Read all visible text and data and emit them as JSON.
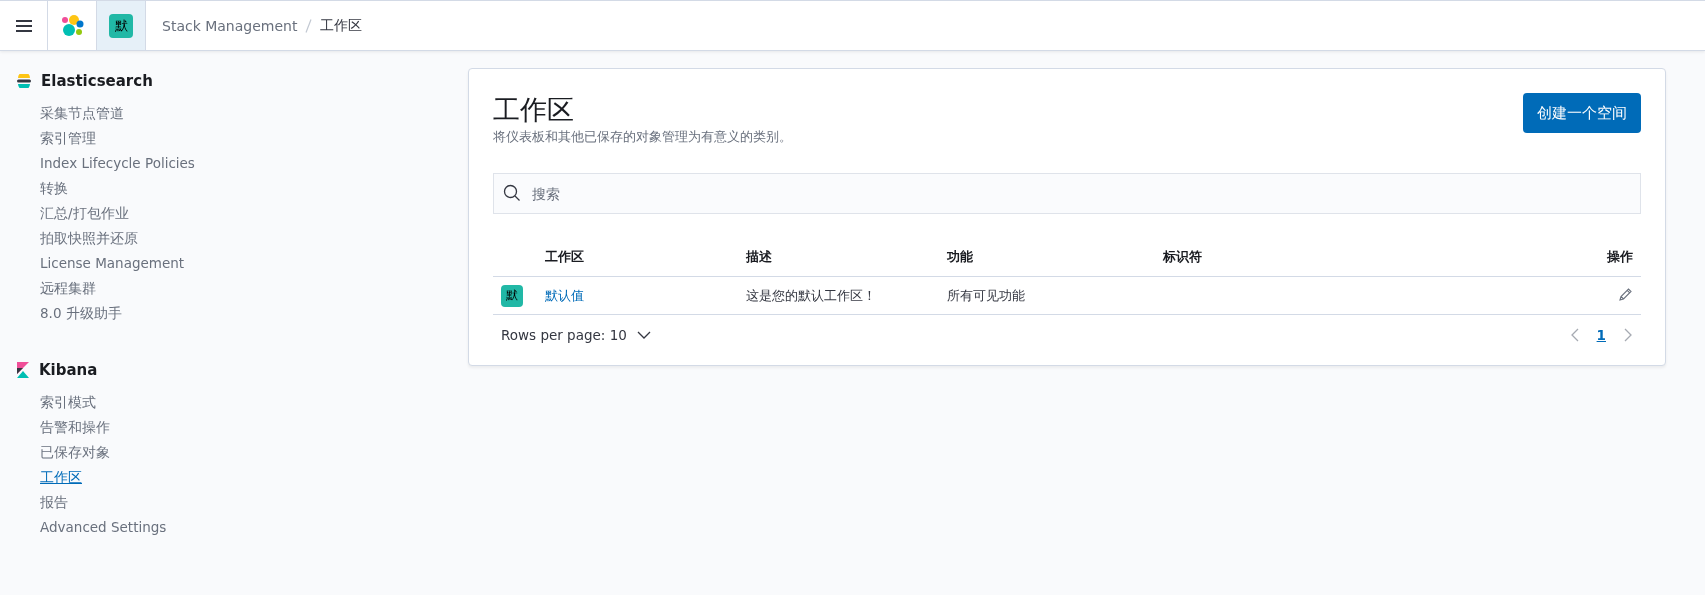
{
  "header": {
    "avatar": "默",
    "breadcrumbs": [
      {
        "label": "Stack Management",
        "selected": false
      },
      {
        "label": "工作区",
        "selected": true
      }
    ]
  },
  "sidebar": {
    "sections": [
      {
        "kind": "elasticsearch",
        "title": "Elasticsearch",
        "items": [
          {
            "label": "采集节点管道",
            "selected": false
          },
          {
            "label": "索引管理",
            "selected": false
          },
          {
            "label": "Index Lifecycle Policies",
            "selected": false
          },
          {
            "label": "转换",
            "selected": false
          },
          {
            "label": "汇总/打包作业",
            "selected": false
          },
          {
            "label": "拍取快照并还原",
            "selected": false
          },
          {
            "label": "License Management",
            "selected": false
          },
          {
            "label": "远程集群",
            "selected": false
          },
          {
            "label": "8.0 升级助手",
            "selected": false
          }
        ]
      },
      {
        "kind": "kibana",
        "title": "Kibana",
        "items": [
          {
            "label": "索引模式",
            "selected": false
          },
          {
            "label": "告警和操作",
            "selected": false
          },
          {
            "label": "已保存对象",
            "selected": false
          },
          {
            "label": "工作区",
            "selected": true
          },
          {
            "label": "报告",
            "selected": false
          },
          {
            "label": "Advanced Settings",
            "selected": false
          }
        ]
      }
    ]
  },
  "page": {
    "title": "工作区",
    "description": "将仪表板和其他已保存的对象管理为有意义的类别。",
    "create_button": "创建一个空间",
    "search": {
      "placeholder": "搜索"
    },
    "table": {
      "columns": [
        "工作区",
        "描述",
        "功能",
        "标识符",
        "操作"
      ],
      "rows": [
        {
          "avatar": "默",
          "color": "#21b8a6",
          "name": "默认值",
          "description": "这是您的默认工作区！",
          "features": "所有可见功能",
          "identifier": ""
        }
      ]
    },
    "pagination": {
      "rows_per_page": "Rows per page: 10",
      "pages": [
        {
          "label": "1",
          "selected": true
        }
      ]
    }
  }
}
